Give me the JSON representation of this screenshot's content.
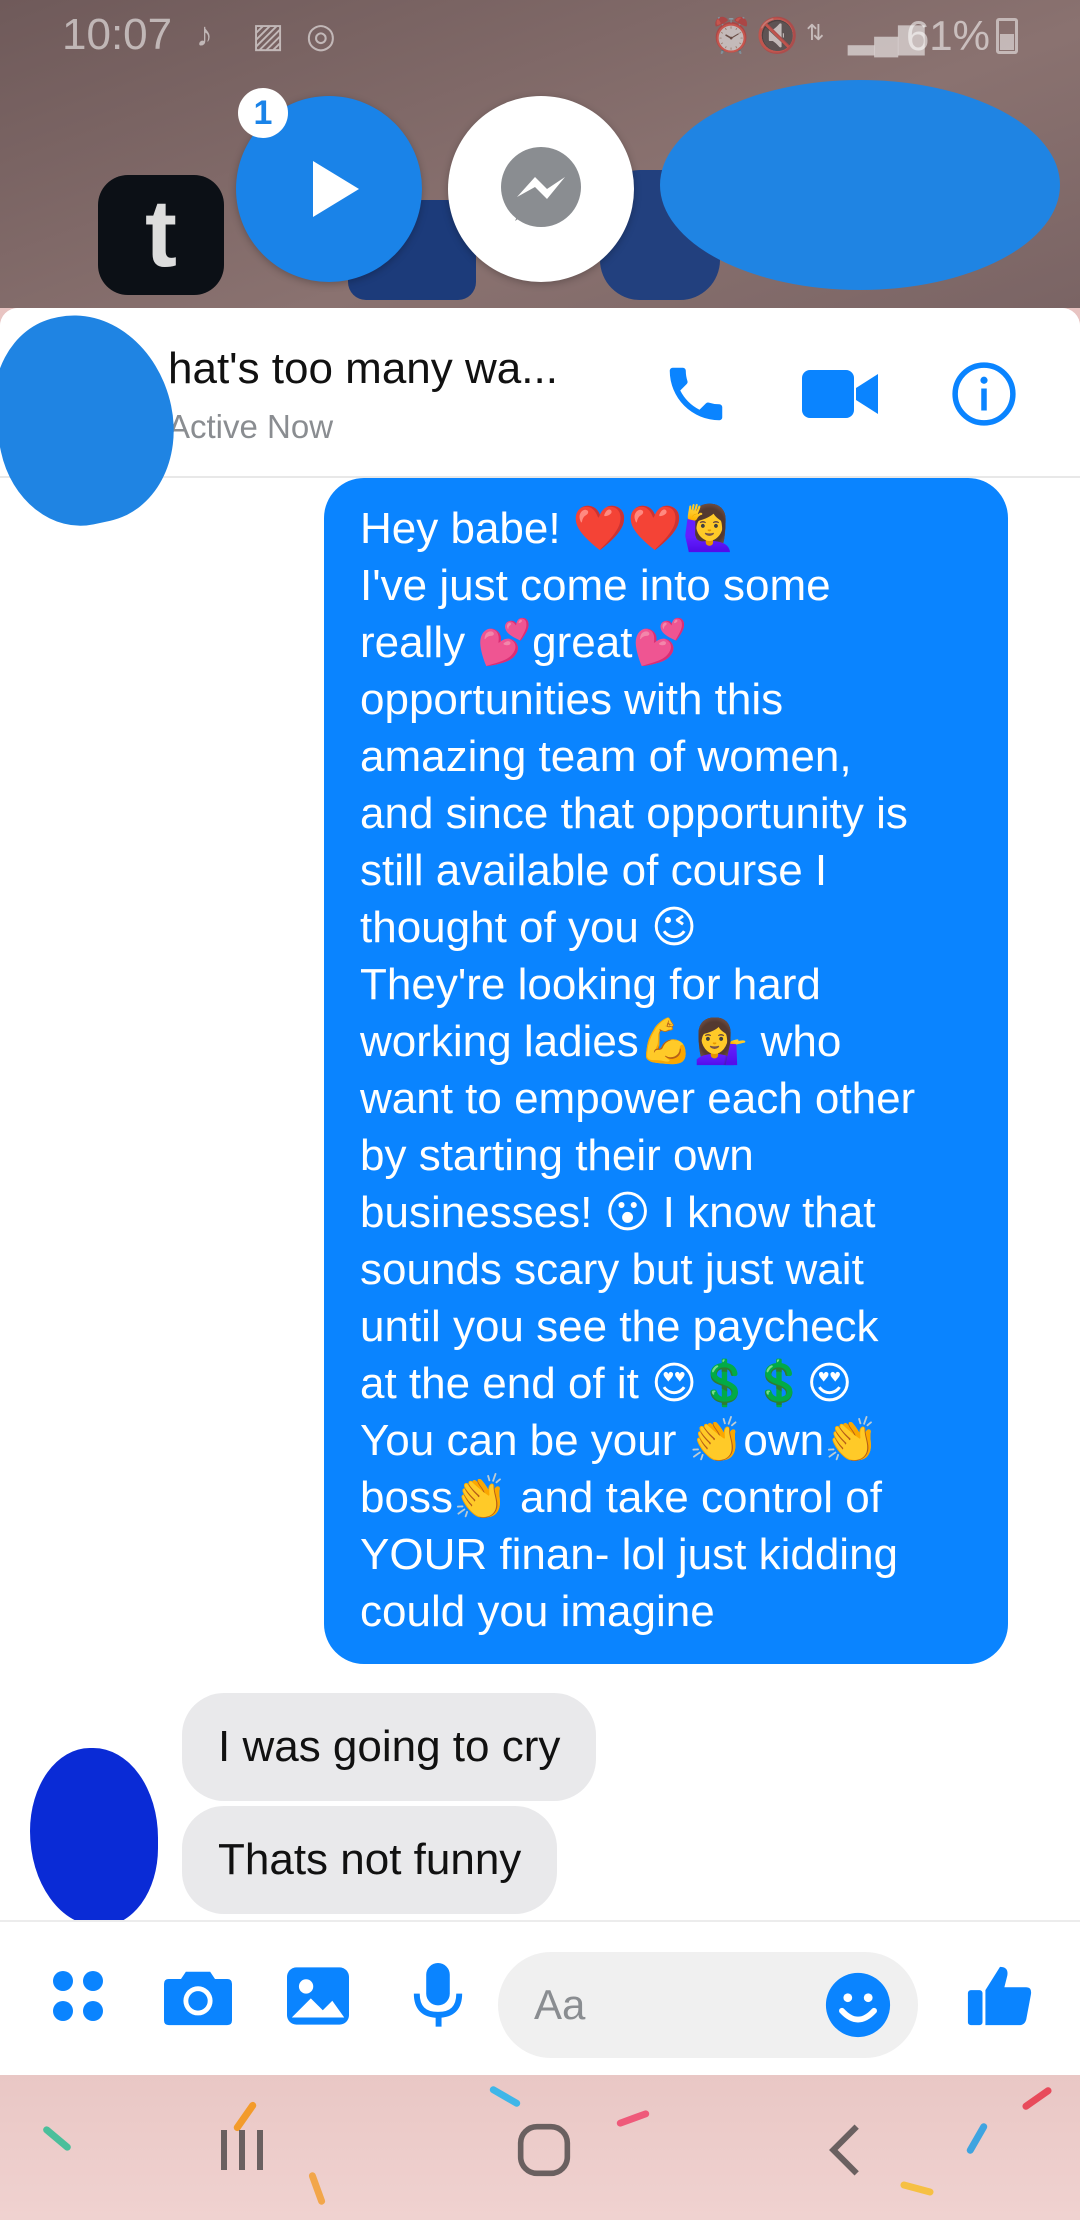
{
  "status_bar": {
    "time": "10:07",
    "battery": "61%",
    "icons": [
      "music-note-icon",
      "image-icon",
      "messenger-icon",
      "alarm-icon",
      "mute-icon",
      "data-icon",
      "signal-icon",
      "battery-icon"
    ]
  },
  "chat_heads": {
    "badge_count": "1",
    "tumblr_letter": "t"
  },
  "header": {
    "title": "hat's too many wa...",
    "status": "Active Now",
    "accent": "#0a84ff"
  },
  "messages": {
    "outgoing_lines": [
      "Hey babe! ❤️❤️🙋‍♀️",
      "I've just come into some",
      "really 💕great💕",
      "opportunities with this",
      "amazing team of women,",
      "and since that opportunity is",
      "still available of course I",
      "thought of you 😉",
      "They're looking for hard",
      "working ladies💪💁‍♀️ who",
      "want to empower each other",
      "by starting their own",
      "businesses! 😮 I know that",
      "sounds scary but just wait",
      "until you see the paycheck",
      "at the end of it 😍💲💲😍",
      "You can be your 👏own👏",
      "boss👏 and take control of",
      "YOUR finan- lol just kidding",
      "could you imagine"
    ],
    "incoming": [
      "I was going to cry",
      "Thats not funny"
    ],
    "outgoing_color": "#0a84ff",
    "incoming_color": "#e9e9eb"
  },
  "composer": {
    "placeholder": "Aa"
  }
}
